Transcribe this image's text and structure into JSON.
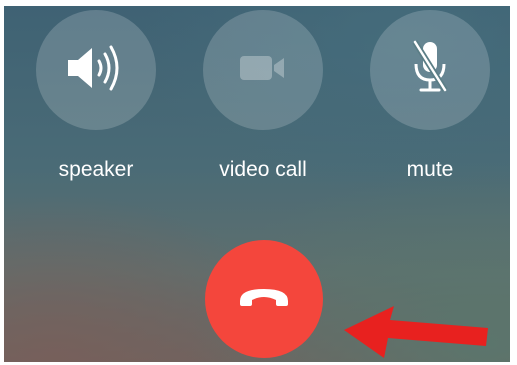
{
  "call_controls": {
    "speaker": {
      "label": "speaker",
      "icon": "speaker-icon"
    },
    "video_call": {
      "label": "video call",
      "icon": "video-camera-icon",
      "disabled": true
    },
    "mute": {
      "label": "mute",
      "icon": "microphone-muted-icon"
    }
  },
  "end_call": {
    "icon": "phone-hangup-icon",
    "color": "#f4463c"
  },
  "annotation": {
    "icon": "red-arrow-icon",
    "color": "#e8211f"
  }
}
